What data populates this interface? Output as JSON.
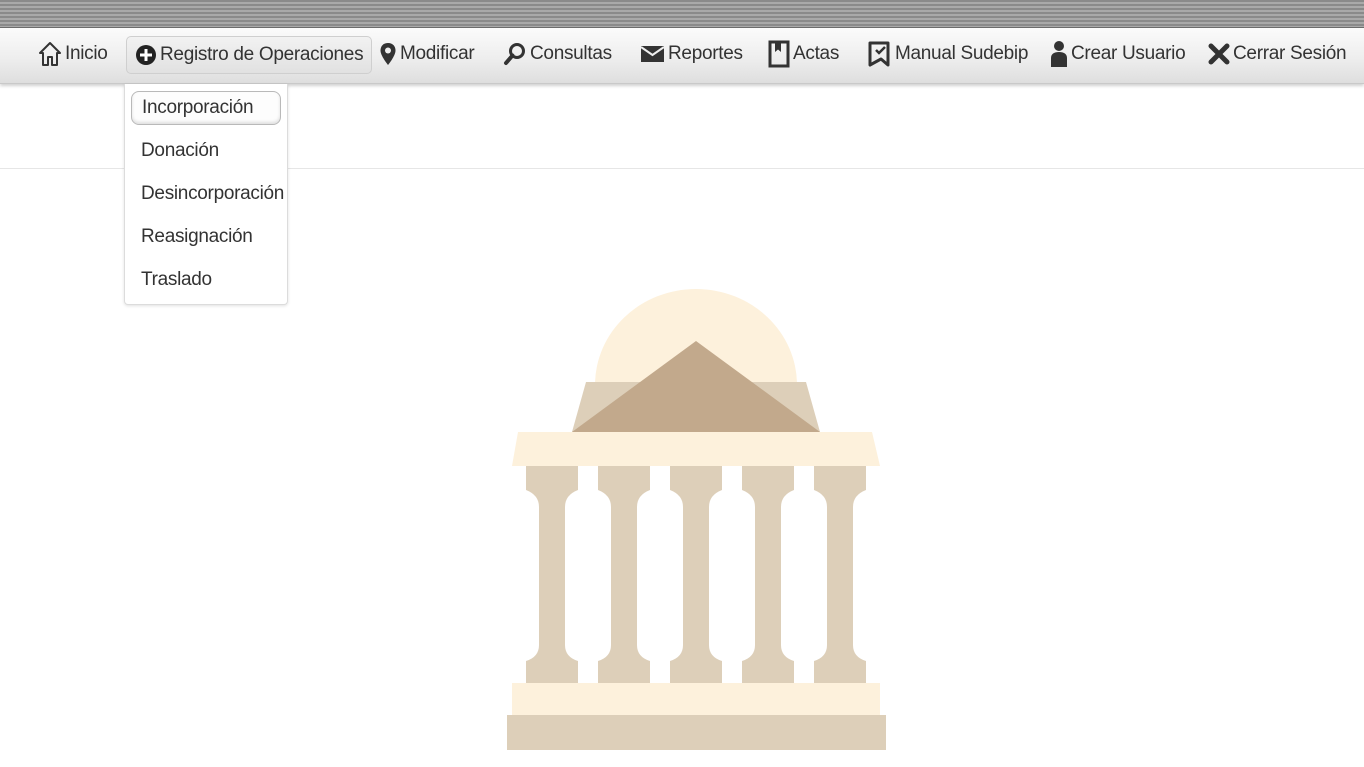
{
  "nav": {
    "items": [
      {
        "label": "Inicio",
        "icon": "home-icon"
      },
      {
        "label": "Registro de Operaciones",
        "icon": "plus-circle-icon",
        "active": true
      },
      {
        "label": "Modificar",
        "icon": "map-pin-icon"
      },
      {
        "label": "Consultas",
        "icon": "search-icon"
      },
      {
        "label": "Reportes",
        "icon": "envelope-icon"
      },
      {
        "label": "Actas",
        "icon": "bookmark-icon"
      },
      {
        "label": "Manual Sudebip",
        "icon": "book-icon"
      },
      {
        "label": "Crear Usuario",
        "icon": "user-icon"
      },
      {
        "label": "Cerrar Sesión",
        "icon": "close-icon"
      }
    ]
  },
  "dropdown": {
    "items": [
      {
        "label": "Incorporación",
        "active": true
      },
      {
        "label": "Donación"
      },
      {
        "label": "Desincorporación"
      },
      {
        "label": "Reasignación"
      },
      {
        "label": "Traslado"
      }
    ]
  },
  "illustration": {
    "icon": "government-building-icon",
    "colors": {
      "light": "#fdf1dc",
      "mid": "#ddcfb9",
      "dark": "#c2a98c"
    }
  }
}
